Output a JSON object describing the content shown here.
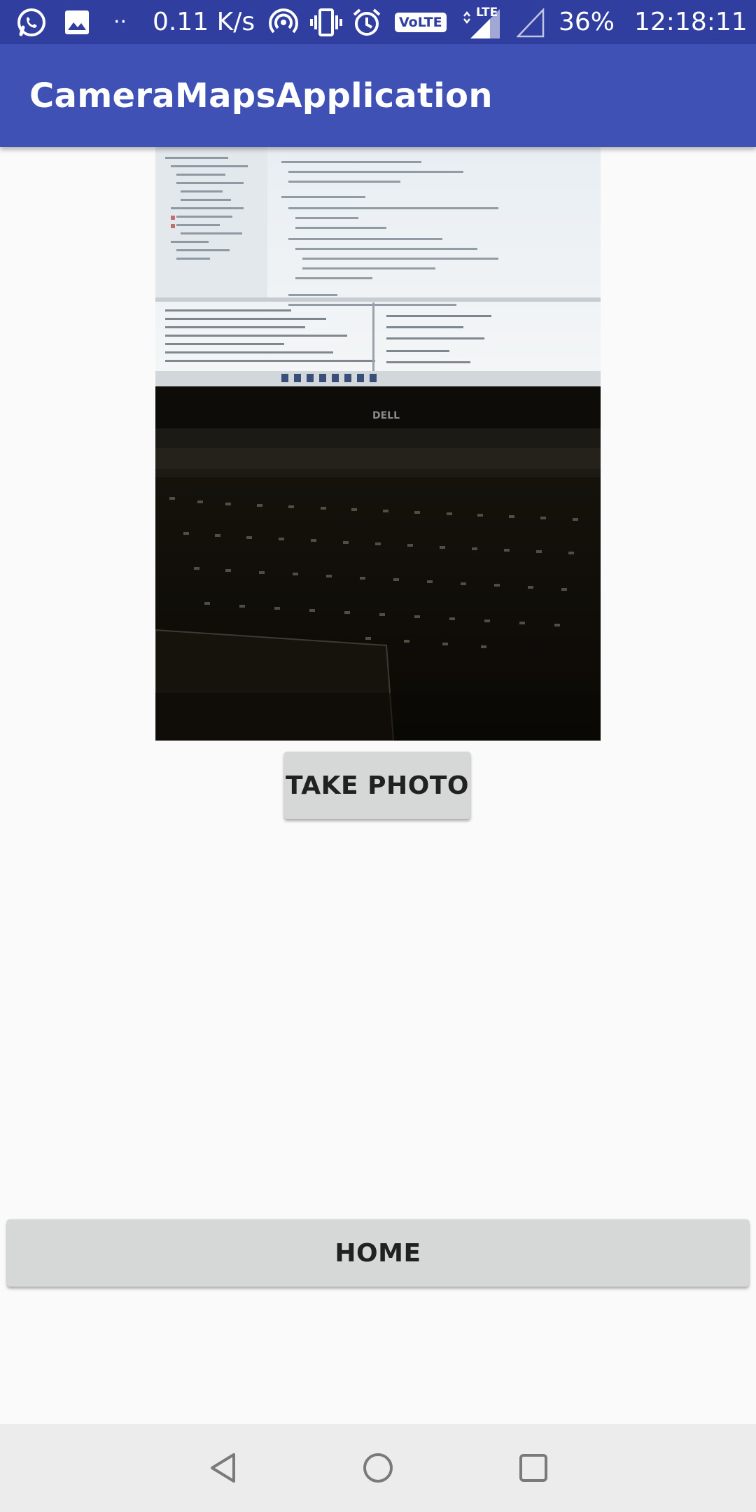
{
  "status_bar": {
    "network_speed": "0.11 K/s",
    "dots": "··",
    "volte_label": "VoLTE",
    "lte_label": "LTE",
    "battery": "36%",
    "time": "12:18:11",
    "icons": [
      "whatsapp-icon",
      "image-icon",
      "hotspot-icon",
      "vibrate-icon",
      "alarm-icon",
      "volte-icon",
      "signal-icon",
      "signal-empty-icon"
    ]
  },
  "app_bar": {
    "title": "CameraMapsApplication"
  },
  "preview": {
    "description_icon": "captured-photo-laptop",
    "brand_text": "DELL"
  },
  "buttons": {
    "take_photo": "TAKE PHOTO",
    "home": "HOME"
  },
  "nav_bar": {
    "icons": [
      "back-icon",
      "home-circle-icon",
      "recents-icon"
    ]
  },
  "colors": {
    "status_bar": "#303f9f",
    "app_bar": "#3f51b5",
    "background": "#fafafa",
    "button": "#d6d7d7",
    "nav_bar": "#ececec"
  }
}
